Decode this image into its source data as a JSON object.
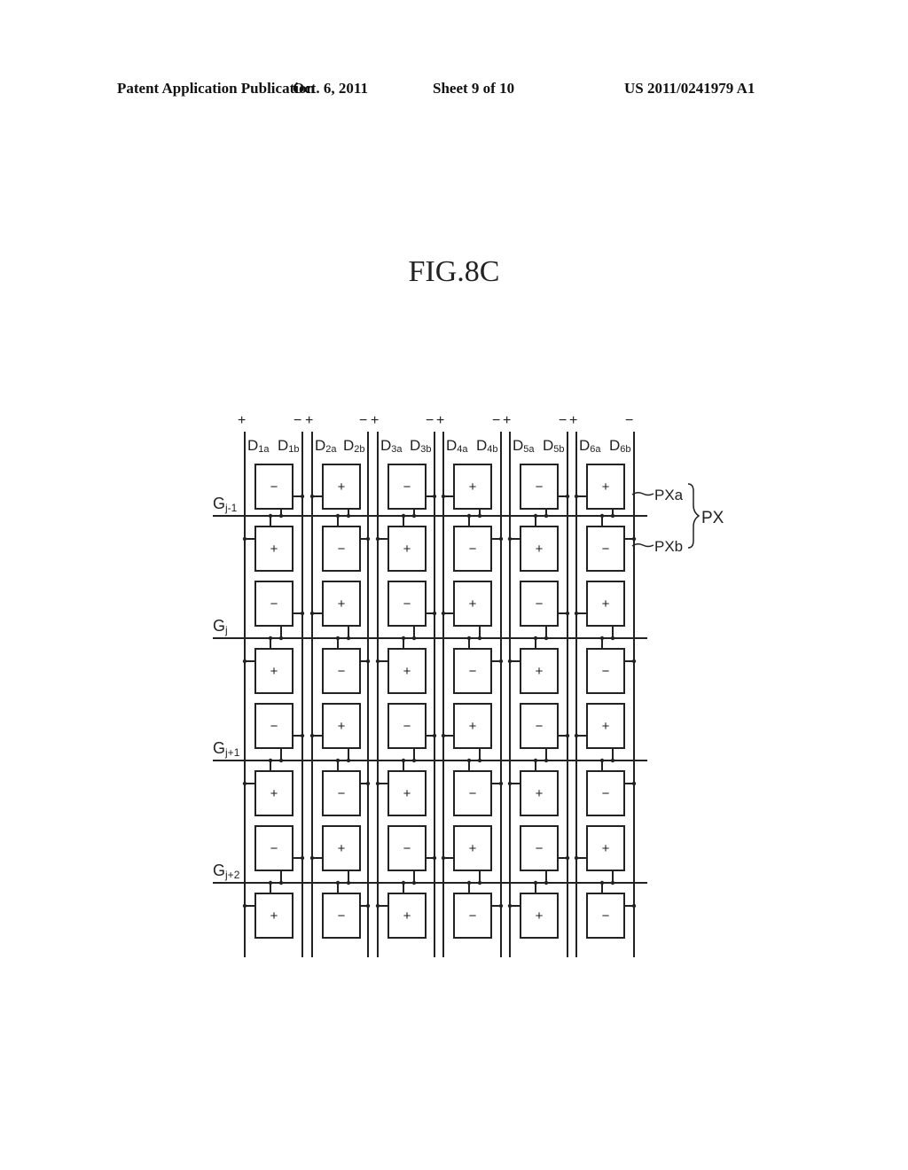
{
  "header": {
    "publication": "Patent Application Publication",
    "date": "Oct. 6, 2011",
    "sheet": "Sheet 9 of 10",
    "number": "US 2011/0241979 A1"
  },
  "figure": {
    "title": "FIG.8C",
    "columns": [
      {
        "a": "D",
        "a_sub": "1a",
        "b": "D",
        "b_sub": "1b",
        "top_a": "+",
        "top_b": "−"
      },
      {
        "a": "D",
        "a_sub": "2a",
        "b": "D",
        "b_sub": "2b",
        "top_a": "+",
        "top_b": "−"
      },
      {
        "a": "D",
        "a_sub": "3a",
        "b": "D",
        "b_sub": "3b",
        "top_a": "+",
        "top_b": "−"
      },
      {
        "a": "D",
        "a_sub": "4a",
        "b": "D",
        "b_sub": "4b",
        "top_a": "+",
        "top_b": "−"
      },
      {
        "a": "D",
        "a_sub": "5a",
        "b": "D",
        "b_sub": "5b",
        "top_a": "+",
        "top_b": "−"
      },
      {
        "a": "D",
        "a_sub": "6a",
        "b": "D",
        "b_sub": "6b",
        "top_a": "+",
        "top_b": "−"
      }
    ],
    "gate_lines": [
      {
        "label": "G",
        "sub": "j-1"
      },
      {
        "label": "G",
        "sub": "j"
      },
      {
        "label": "G",
        "sub": "j+1"
      },
      {
        "label": "G",
        "sub": "j+2"
      }
    ],
    "pixel_polarity": [
      [
        "−",
        "+",
        "−",
        "+",
        "−",
        "+"
      ],
      [
        "+",
        "−",
        "+",
        "−",
        "+",
        "−"
      ],
      [
        "−",
        "+",
        "−",
        "+",
        "−",
        "+"
      ],
      [
        "+",
        "−",
        "+",
        "−",
        "+",
        "−"
      ],
      [
        "−",
        "+",
        "−",
        "+",
        "−",
        "+"
      ],
      [
        "+",
        "−",
        "+",
        "−",
        "+",
        "−"
      ],
      [
        "−",
        "+",
        "−",
        "+",
        "−",
        "+"
      ],
      [
        "+",
        "−",
        "+",
        "−",
        "+",
        "−"
      ]
    ],
    "callouts": {
      "pxa": "PXa",
      "pxb": "PXb",
      "px": "PX"
    }
  }
}
